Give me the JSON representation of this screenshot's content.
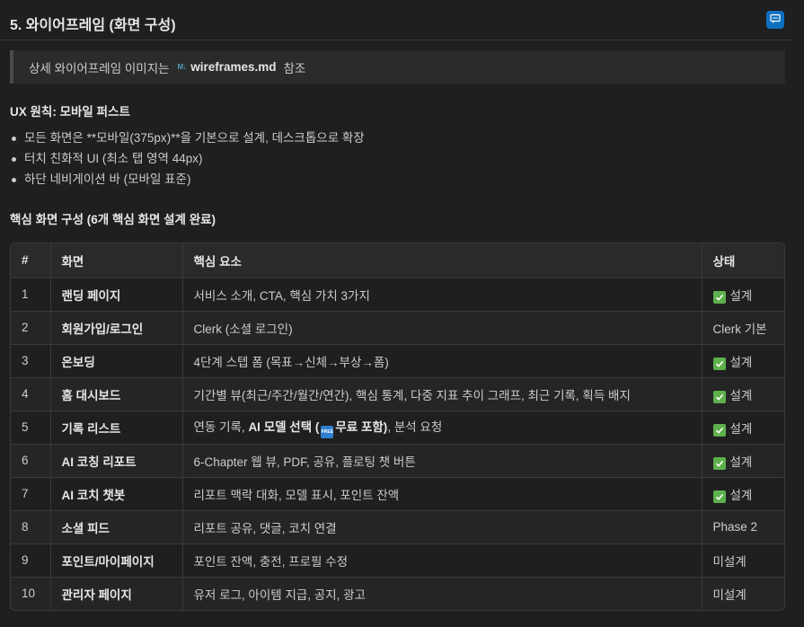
{
  "heading": "5. 와이어프레임 (화면 구성)",
  "quote": {
    "text": "상세 와이어프레임 이미지는",
    "badge": "M↓",
    "link": "wireframes.md",
    "suffix": "참조"
  },
  "ux_title": "UX 원칙: 모바일 퍼스트",
  "ux_items": [
    "모든 화면은 **모바일(375px)**을 기본으로 설계, 데스크톱으로 확장",
    "터치 친화적 UI (최소 탭 영역 44px)",
    "하단 네비게이션 바 (모바일 표준)"
  ],
  "section_title": "핵심 화면 구성 (6개 핵심 화면 설계 완료)",
  "table": {
    "headers": [
      "#",
      "화면",
      "핵심 요소",
      "상태"
    ],
    "rows": [
      {
        "num": "1",
        "screen": "랜딩 페이지",
        "elements": "서비스 소개, CTA, 핵심 가치 3가지",
        "status": "설계",
        "done": true
      },
      {
        "num": "2",
        "screen": "회원가입/로그인",
        "elements": "Clerk (소셜 로그인)",
        "status": "Clerk 기본",
        "done": false
      },
      {
        "num": "3",
        "screen": "온보딩",
        "elements": "4단계 스텝 폼 (목표→신체→부상→폼)",
        "status": "설계",
        "done": true
      },
      {
        "num": "4",
        "screen": "홈 대시보드",
        "elements": "기간별 뷰(최근/주간/월간/연간), 핵심 통계, 다중 지표 추이 그래프, 최근 기록, 획득 배지",
        "status": "설계",
        "done": true
      },
      {
        "num": "5",
        "screen": "기록 리스트",
        "elements_pre": "연동 기록, ",
        "elements_bold": "AI 모델 선택 (",
        "free_badge": "FREE",
        "elements_bold2": "무료 포함)",
        "elements_post": ", 분석 요청",
        "status": "설계",
        "done": true
      },
      {
        "num": "6",
        "screen": "AI 코칭 리포트",
        "elements": "6-Chapter 웹 뷰, PDF, 공유, 플로팅 챗 버튼",
        "status": "설계",
        "done": true
      },
      {
        "num": "7",
        "screen": "AI 코치 챗봇",
        "elements": "리포트 맥락 대화, 모델 표시, 포인트 잔액",
        "status": "설계",
        "done": true
      },
      {
        "num": "8",
        "screen": "소셜 피드",
        "elements": "리포트 공유, 댓글, 코치 연결",
        "status": "Phase 2",
        "done": false
      },
      {
        "num": "9",
        "screen": "포인트/마이페이지",
        "elements": "포인트 잔액, 충전, 프로필 수정",
        "status": "미설계",
        "done": false
      },
      {
        "num": "10",
        "screen": "관리자 페이지",
        "elements": "유저 로그, 아이템 지급, 공지, 광고",
        "status": "미설계",
        "done": false
      }
    ]
  },
  "colors": {
    "background": "#1f1f1f",
    "check": "#5db04c",
    "accent": "#0e70c0"
  }
}
